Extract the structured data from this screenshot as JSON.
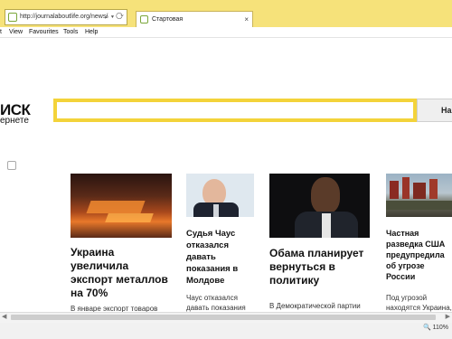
{
  "browser": {
    "url": "http://journalaboutlife.org/news/",
    "addr_controls": "⌕ ▾ ⟳",
    "tab_title": "Стартовая",
    "tab_close": "×",
    "menu": [
      "t",
      "View",
      "Favourites",
      "Tools",
      "Help"
    ]
  },
  "search": {
    "logo_line1": "ИСК",
    "logo_line2": "ернете",
    "button_label": "Най",
    "accent_color": "#f3d33a"
  },
  "news": [
    {
      "headline": "Украина увеличила экспорт металлов на 70%",
      "snippet": "В январе экспорт товаров",
      "image": "steel-mill-photo"
    },
    {
      "headline": "Судья Чаус отказался давать показания в Молдове",
      "snippet": "Чаус отказался давать показания",
      "image": "judge-portrait-photo"
    },
    {
      "headline": "Обама планирует вернуться в политику",
      "snippet": "В Демократической партии обещают \"реальную битву\" с Трампом",
      "image": "obama-photo"
    },
    {
      "headline": "Частная разведка США предупредила об угрозе России",
      "snippet": "Под угрозой находятся Украина,",
      "image": "military-parade-photo"
    }
  ],
  "status": {
    "zoom": "🔍 110%"
  }
}
